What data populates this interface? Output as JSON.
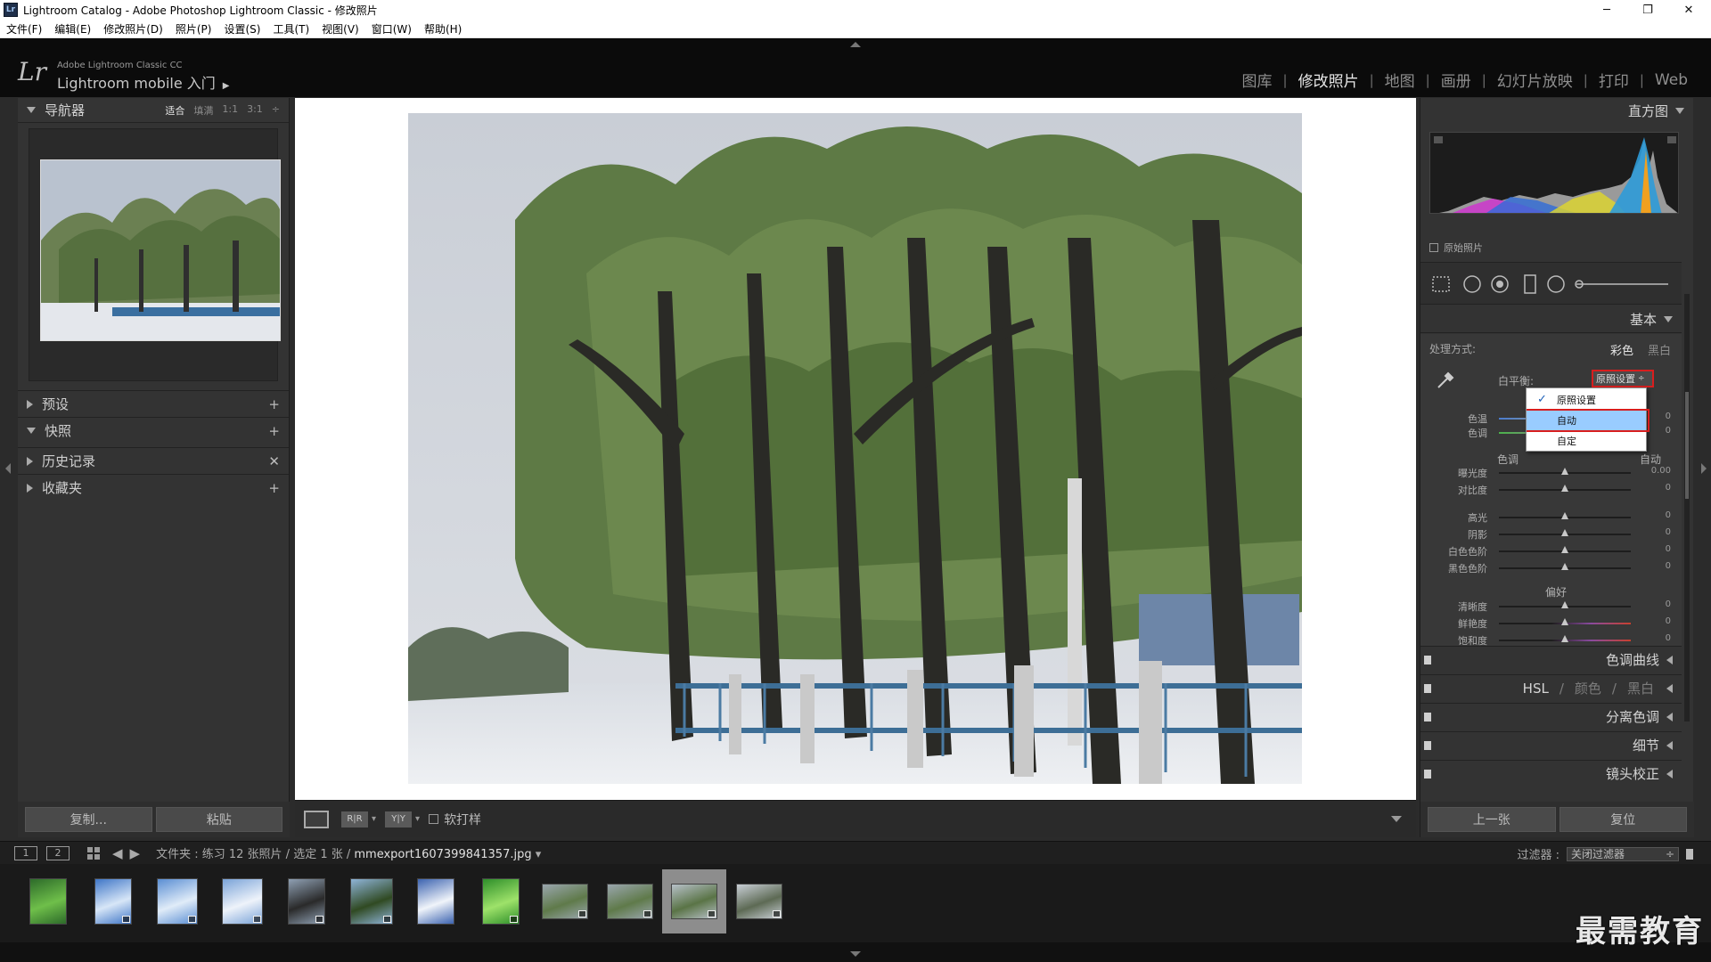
{
  "window": {
    "title": "Lightroom Catalog - Adobe Photoshop Lightroom Classic - 修改照片",
    "app_icon": "Lr",
    "minimize": "─",
    "maximize": "❐",
    "close": "✕"
  },
  "menu": [
    "文件(F)",
    "编辑(E)",
    "修改照片(D)",
    "照片(P)",
    "设置(S)",
    "工具(T)",
    "视图(V)",
    "窗口(W)",
    "帮助(H)"
  ],
  "identity": {
    "logo": "Lr",
    "small": "Adobe Lightroom Classic CC",
    "big": "Lightroom mobile 入门",
    "arrow": "▶"
  },
  "modules": [
    "图库",
    "修改照片",
    "地图",
    "画册",
    "幻灯片放映",
    "打印",
    "Web"
  ],
  "module_separator": "|",
  "active_module": "修改照片",
  "left": {
    "navigator": "导航器",
    "zoom": [
      "适合",
      "填满",
      "1:1",
      "3:1"
    ],
    "zoom_active": "适合",
    "zoom_stepper": "÷",
    "panels": [
      {
        "label": "预设",
        "action": "+"
      },
      {
        "label": "快照",
        "action": "+"
      },
      {
        "label": "历史记录",
        "action": "✕"
      },
      {
        "label": "收藏夹",
        "action": "+"
      }
    ],
    "copy": "复制...",
    "paste": "粘贴"
  },
  "toolbar": {
    "before_after_1": "R|R",
    "before_after_2": "Y|Y",
    "caret": "▾",
    "soft_proof": "软打样"
  },
  "right": {
    "histogram": "直方图",
    "original_photo": "原始照片",
    "basic": "基本",
    "treatment_label": "处理方式:",
    "treatment_color": "彩色",
    "treatment_bw": "黑白",
    "wb_label": "白平衡:",
    "wb_value": "原照设置",
    "wb_caret": "÷",
    "wb_check": "✓",
    "wb_options": [
      "原照设置",
      "自动",
      "自定"
    ],
    "wb_selected": "原照设置",
    "wb_highlighted": "自动",
    "temp_label": "色温",
    "tint_label": "色调",
    "temp_value": "0",
    "tint_value": "0",
    "tone_title": "色调",
    "tone_auto": "自动",
    "sliders_tone": [
      {
        "name": "曝光度",
        "value": "0.00",
        "pos": 0.5
      },
      {
        "name": "对比度",
        "value": "0",
        "pos": 0.5
      }
    ],
    "sliders_tone2": [
      {
        "name": "高光",
        "value": "0",
        "pos": 0.5
      },
      {
        "name": "阴影",
        "value": "0",
        "pos": 0.5
      },
      {
        "name": "白色色阶",
        "value": "0",
        "pos": 0.5
      },
      {
        "name": "黑色色阶",
        "value": "0",
        "pos": 0.5
      }
    ],
    "presence_title": "偏好",
    "sliders_presence": [
      {
        "name": "清晰度",
        "value": "0",
        "pos": 0.5
      },
      {
        "name": "鲜艳度",
        "value": "0",
        "pos": 0.5
      },
      {
        "name": "饱和度",
        "value": "0",
        "pos": 0.5
      }
    ],
    "sections": [
      "色调曲线",
      "HSL / 颜色 / 黑白",
      "分离色调",
      "细节",
      "镜头校正"
    ],
    "hsl_parts": [
      "HSL",
      "/",
      "颜色",
      "/",
      "黑白"
    ],
    "prev": "上一张",
    "reset": "复位"
  },
  "filmbar": {
    "mon1": "1",
    "mon2": "2",
    "back": "◀",
    "fwd": "▶",
    "path": "文件夹 : 练习    12 张照片 / 选定 1 张 / ",
    "filename": "mmexport1607399841357.jpg",
    "file_caret": "▾",
    "filter_label": "过滤器 :",
    "filter_value": "关闭过滤器",
    "filter_caret": "÷"
  },
  "thumbs": [
    {
      "kind": "leaf",
      "w": 42,
      "h": 52
    },
    {
      "kind": "sky",
      "w": 42,
      "h": 52
    },
    {
      "kind": "sky2",
      "w": 46,
      "h": 52
    },
    {
      "kind": "sky3",
      "w": 46,
      "h": 52
    },
    {
      "kind": "trees",
      "w": 42,
      "h": 52
    },
    {
      "kind": "trees2",
      "w": 48,
      "h": 52
    },
    {
      "kind": "cloud",
      "w": 42,
      "h": 52
    },
    {
      "kind": "green",
      "w": 42,
      "h": 52
    },
    {
      "kind": "snow",
      "w": 52,
      "h": 40
    },
    {
      "kind": "snow",
      "w": 52,
      "h": 40
    },
    {
      "kind": "snow2",
      "w": 52,
      "h": 40
    },
    {
      "kind": "road",
      "w": 52,
      "h": 40
    }
  ],
  "selected_thumb": 10,
  "watermark": "最需教育",
  "colors": {
    "accent_red": "#d81e1e",
    "highlight": "#99ccff",
    "panel": "#333333"
  }
}
